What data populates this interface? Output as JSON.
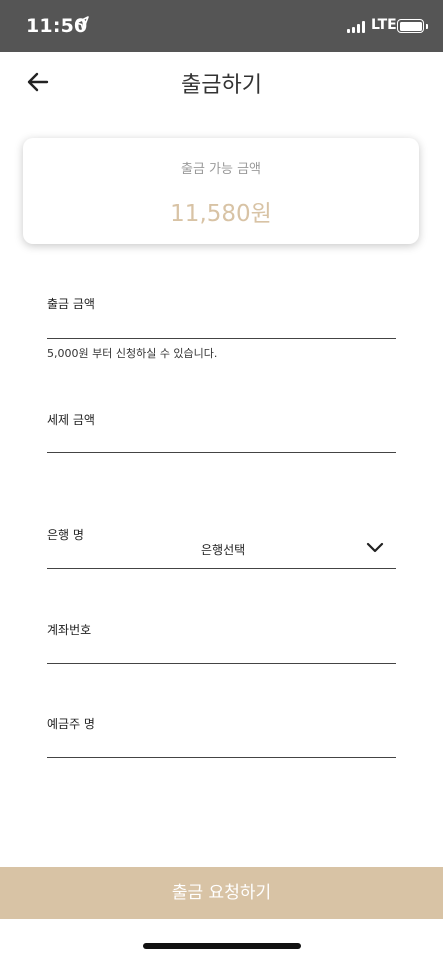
{
  "status_bar": {
    "time": "11:50",
    "network": "LTE",
    "location_icon": "location-arrow-icon",
    "signal_icon": "cellular-signal-icon",
    "battery_icon": "battery-icon"
  },
  "header": {
    "title": "출금하기",
    "back_icon": "arrow-left-icon"
  },
  "balance_card": {
    "label": "출금 가능 금액",
    "amount": "11,580원"
  },
  "form": {
    "withdraw_amount": {
      "label": "출금 금액",
      "value": "",
      "hint": "5,000원 부터 신청하실 수 있습니다."
    },
    "tax_amount": {
      "label": "세제 금액",
      "value": ""
    },
    "bank_name": {
      "label": "은행 명",
      "selected": "은행선택",
      "icon": "chevron-down-icon"
    },
    "account_number": {
      "label": "계좌번호",
      "value": ""
    },
    "account_holder": {
      "label": "예금주 명",
      "value": ""
    }
  },
  "submit": {
    "label": "출금 요청하기"
  },
  "colors": {
    "accent": "#d8c3a5",
    "status_bar": "#555555",
    "muted_text": "#9a9a9a"
  }
}
